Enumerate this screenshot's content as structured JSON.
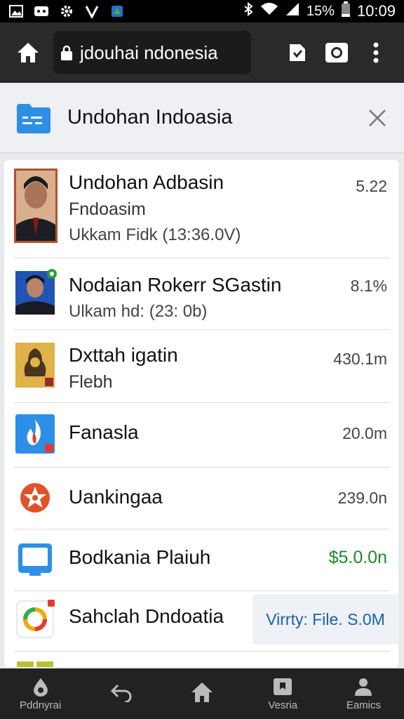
{
  "statusbar": {
    "battery_text": "15%",
    "time": "10:09"
  },
  "toolbar": {
    "url_text": "jdouhai ndonesia"
  },
  "page_header": {
    "title": "Undohan Indoasia"
  },
  "items": [
    {
      "title": "Undohan Adbasin",
      "subtitle": "Fndoasim",
      "meta": "Ukkam Fidk (13:36.0V)",
      "size": "5.22"
    },
    {
      "title": "Nodaian Rokerr SGastin",
      "subtitle": "",
      "meta": "Ulkam hd: (23: 0b)",
      "size": "8.1%"
    },
    {
      "title": "Dxttah igatin",
      "subtitle": "Flebh",
      "meta": "",
      "size": "430.1m"
    },
    {
      "title": "Fanasla",
      "subtitle": "",
      "meta": "",
      "size": "20.0m"
    },
    {
      "title": "Uankingaa",
      "subtitle": "",
      "meta": "",
      "size": "239.0n"
    },
    {
      "title": "Bodkania Plaiuh",
      "subtitle": "",
      "meta": "",
      "size": "$5.0.0n"
    },
    {
      "title": "Sahclah Dndoatia",
      "subtitle": "",
      "meta": "",
      "size": ""
    }
  ],
  "popup": {
    "text": "Virrty: File. S.0M"
  },
  "bottom_nav": [
    {
      "label": "Pddnyrai",
      "icon": "drop-icon"
    },
    {
      "label": "",
      "icon": "back-arrow-icon"
    },
    {
      "label": "",
      "icon": "home-icon"
    },
    {
      "label": "Vesria",
      "icon": "bookmark-icon"
    },
    {
      "label": "Eamics",
      "icon": "person-icon"
    }
  ],
  "colors": {
    "accent_blue": "#2d8fe8",
    "size_green": "#1a8a2d",
    "toolbar": "#2a2a2a"
  }
}
